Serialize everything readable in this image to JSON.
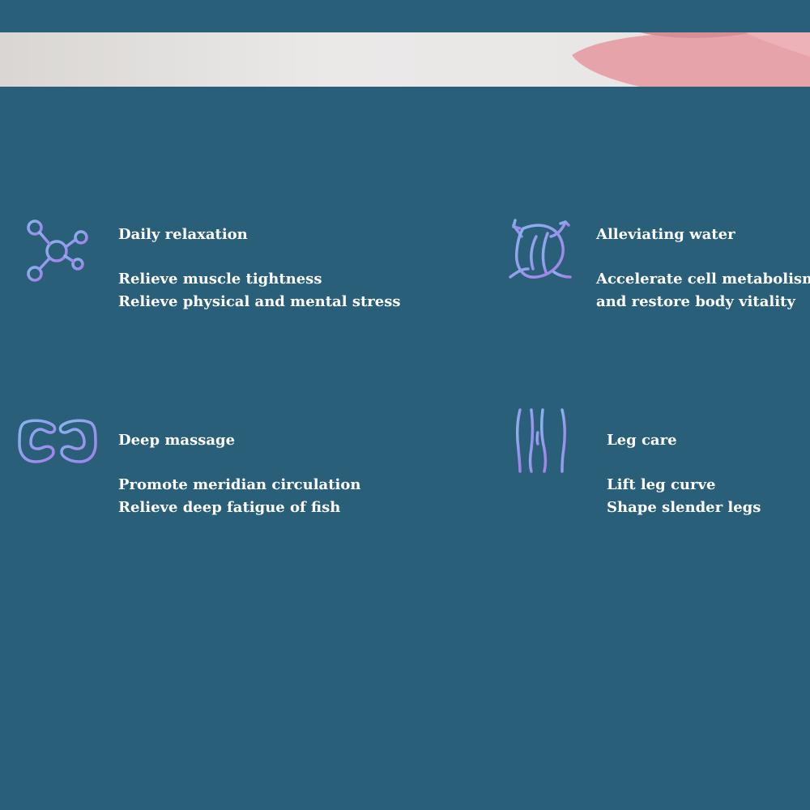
{
  "colors": {
    "background": "#2a5f7a",
    "text": "#ffffff",
    "icon_gradient_start": "#7eaee8",
    "icon_gradient_end": "#a780ea",
    "banner": "#e6e4e3",
    "shoe": "#e9a7ad"
  },
  "features": [
    {
      "icon": "molecule-network-icon",
      "title": "Daily relaxation",
      "lines": [
        "Relieve muscle tightness",
        "Relieve physical and mental stress"
      ]
    },
    {
      "icon": "muscle-rotation-icon",
      "title": "Alleviating water",
      "lines": [
        "Accelerate cell metabolism",
        "and restore body vitality"
      ]
    },
    {
      "icon": "hands-massage-icon",
      "title": "Deep massage",
      "lines": [
        "Promote meridian circulation",
        "Relieve deep fatigue of fish"
      ]
    },
    {
      "icon": "legs-icon",
      "title": "Leg care",
      "lines": [
        "Lift leg curve",
        "Shape slender legs"
      ]
    }
  ]
}
